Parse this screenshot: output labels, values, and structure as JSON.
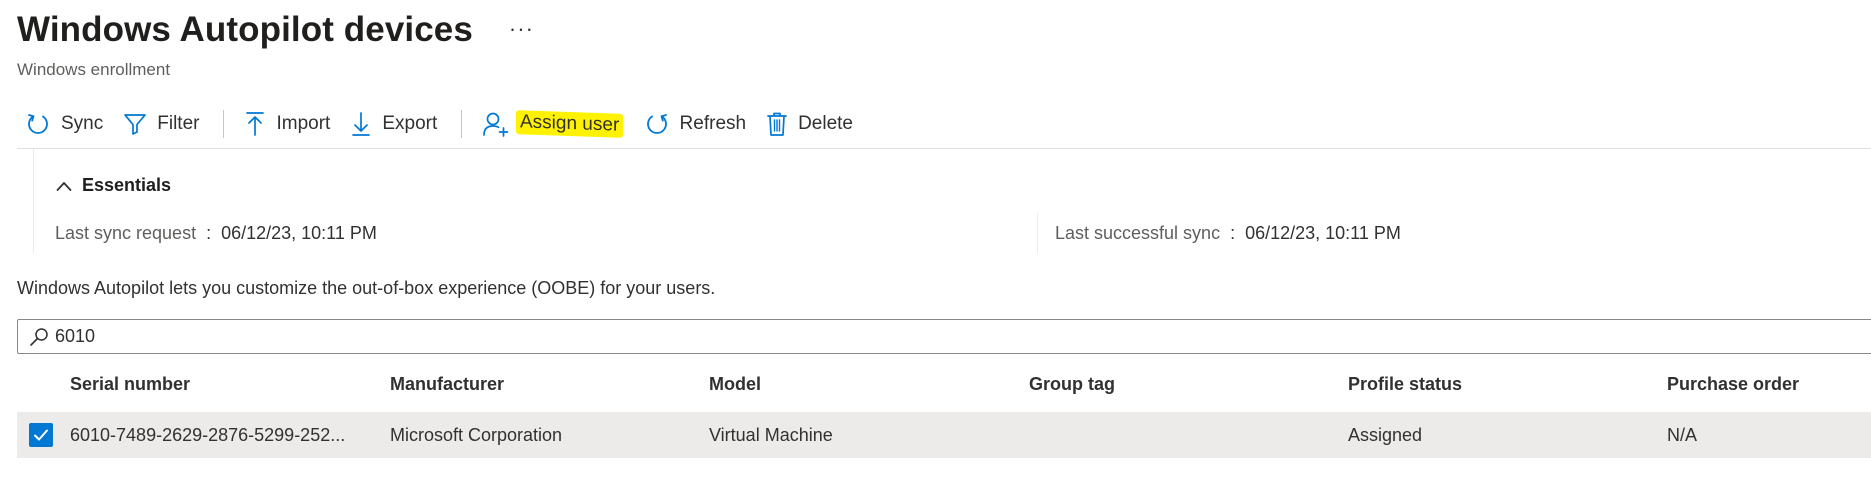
{
  "header": {
    "title": "Windows Autopilot devices",
    "more": "···",
    "subtitle": "Windows enrollment"
  },
  "toolbar": {
    "sync": "Sync",
    "filter": "Filter",
    "import": "Import",
    "export": "Export",
    "assign_user": "Assign user",
    "refresh": "Refresh",
    "delete": "Delete",
    "highlight_color": "#fff200",
    "icon_color": "#0078d4"
  },
  "essentials": {
    "title": "Essentials",
    "last_sync_request_label": "Last sync request",
    "last_sync_request_value": "06/12/23, 10:11 PM",
    "last_successful_sync_label": "Last successful sync",
    "last_successful_sync_value": "06/12/23, 10:11 PM",
    "colon": ":"
  },
  "description": "Windows Autopilot lets you customize the out-of-box experience (OOBE) for your users.",
  "search": {
    "value": "6010"
  },
  "table": {
    "columns": [
      "Serial number",
      "Manufacturer",
      "Model",
      "Group tag",
      "Profile status",
      "Purchase order"
    ],
    "rows": [
      {
        "selected": true,
        "serial": "6010-7489-2629-2876-5299-252...",
        "manufacturer": "Microsoft Corporation",
        "model": "Virtual Machine",
        "group_tag": "",
        "profile_status": "Assigned",
        "purchase_order": "N/A"
      }
    ]
  }
}
